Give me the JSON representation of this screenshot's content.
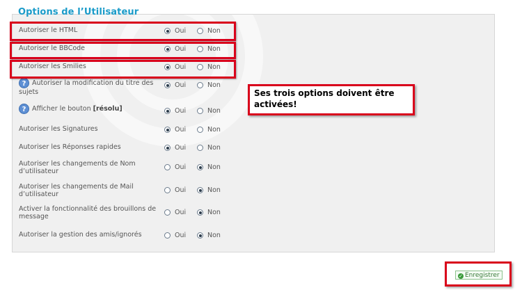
{
  "title": "Options de l’Utilisateur",
  "options": [
    {
      "label": "Autoriser le HTML",
      "help": false,
      "selected": "oui"
    },
    {
      "label": "Autoriser le BBCode",
      "help": false,
      "selected": "oui"
    },
    {
      "label": "Autoriser les Smilies",
      "help": false,
      "selected": "oui"
    },
    {
      "label": "Autoriser la modification du titre des sujets",
      "help": true,
      "selected": "oui"
    },
    {
      "label": "Afficher le bouton [résolu]",
      "help": true,
      "selected": "oui"
    },
    {
      "label": "Autoriser les Signatures",
      "help": false,
      "selected": "oui"
    },
    {
      "label": "Autoriser les Réponses rapides",
      "help": false,
      "selected": "oui"
    },
    {
      "label": "Autoriser les changements de Nom d’utilisateur",
      "help": false,
      "selected": "non"
    },
    {
      "label": "Autoriser les changements de Mail d’utilisateur",
      "help": false,
      "selected": "non"
    },
    {
      "label": "Activer la fonctionnalité des brouillons de message",
      "help": false,
      "selected": "non"
    },
    {
      "label": "Autoriser la gestion des amis/ignorés",
      "help": false,
      "selected": "non"
    }
  ],
  "choice_labels": {
    "oui": "Oui",
    "non": "Non"
  },
  "help_icon": "?",
  "annotation": "Ses trois options doivent être activées!",
  "save_button": {
    "label": "Enregistrer",
    "icon": "check-icon"
  },
  "colors": {
    "accent": "#1a9bc9",
    "highlight": "#d9001b",
    "save": "#3a9a3a"
  }
}
